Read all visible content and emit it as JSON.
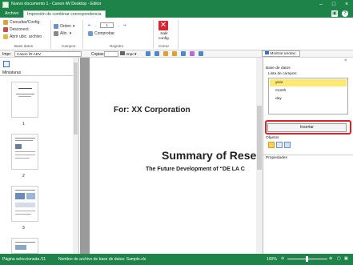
{
  "window": {
    "title": "Nuevo documento 1 - Canon iW Desktop - Editor"
  },
  "tabs": [
    {
      "label": "Archivo"
    },
    {
      "label": "Impresión de combinar correspondencia"
    }
  ],
  "ribbon": {
    "datos": {
      "consult": "Consultar/Config.",
      "desconect": "Desconect.",
      "abrir": "Abrir ubic. archivo",
      "group": "Base datos"
    },
    "campos": {
      "orden": "Orden",
      "alin": "Alin.",
      "group": "Campos"
    },
    "registro": {
      "value": "1",
      "comprobar": "Comprobar",
      "group": "Registro"
    },
    "cerrar": {
      "salir_line1": "Salir",
      "salir_line2": "config.",
      "group": "Cerrar"
    }
  },
  "toolbar": {
    "printer_label": "Impr:",
    "printer_value": "Canon iR-ADV",
    "copies_label": "Copias:",
    "print_btn": "Impr.",
    "mostrar": "Mostrar anotac."
  },
  "left_panel": {
    "title": "Miniaturas",
    "pages": [
      "1",
      "2",
      "3"
    ]
  },
  "document": {
    "line1": "For: XX Corporation",
    "heading": "Summary of Rese",
    "subheading": "The Future Development of “DE LA C"
  },
  "right_panel": {
    "section_db": "Base de datos",
    "field_list_label": "Lista de campos:",
    "fields": [
      "year",
      "month",
      "day"
    ],
    "insert_btn": "Insertar",
    "section_objects": "Objetos",
    "section_props": "Propiedades"
  },
  "status": {
    "pages": "Página seleccionada /11",
    "dbfile": "Nombre de archivo de base de datos: Sample.xls",
    "zoom": "100%"
  },
  "colors": {
    "brand": "#1d8348",
    "highlight": "#e21f26",
    "field_selected": "#ffe873"
  }
}
